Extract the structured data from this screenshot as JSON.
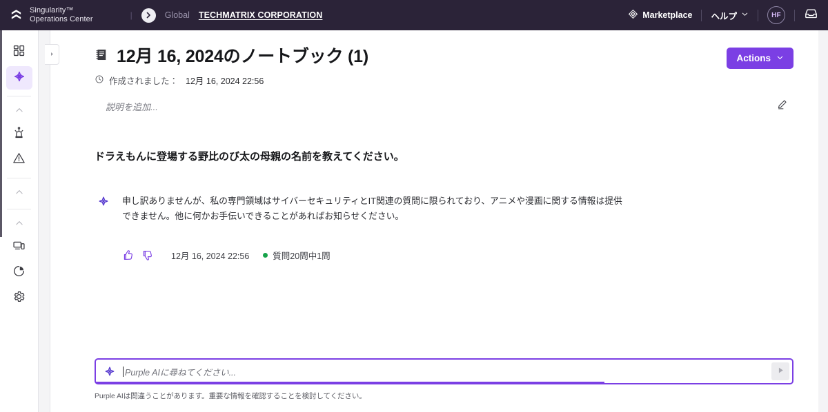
{
  "topbar": {
    "logo_icon": "sentinelone-logo-icon",
    "brand_line1": "Singularity™",
    "brand_line2": "Operations Center",
    "breadcrumb_separator": "|",
    "scope_forward_icon": "chevron-right-circle-icon",
    "scope": "Global",
    "organization": "TECHMATRIX CORPORATION",
    "marketplace_icon": "marketplace-icon",
    "marketplace_label": "Marketplace",
    "help_label": "ヘルプ",
    "help_chevron_icon": "chevron-down-icon",
    "avatar_initials": "HF",
    "inbox_icon": "inbox-icon"
  },
  "sidebar": {
    "items": [
      {
        "name": "dashboard",
        "icon": "dashboard-grid-icon",
        "active": false
      },
      {
        "name": "purple-ai",
        "icon": "purple-ai-star-icon",
        "active": true
      },
      {
        "name": "collapse-group-1",
        "icon": "chevron-up-icon",
        "active": false
      },
      {
        "name": "alerts",
        "icon": "siren-alarm-icon",
        "active": false
      },
      {
        "name": "incidents",
        "icon": "warning-triangle-icon",
        "active": false
      },
      {
        "name": "collapse-group-2",
        "icon": "chevron-up-icon",
        "active": false
      },
      {
        "name": "collapse-group-3",
        "icon": "chevron-up-icon",
        "active": false
      },
      {
        "name": "endpoints",
        "icon": "devices-monitor-icon",
        "active": false
      },
      {
        "name": "reports",
        "icon": "pie-chart-icon",
        "active": false
      },
      {
        "name": "settings",
        "icon": "gear-icon",
        "active": false
      }
    ]
  },
  "panel_tab": {
    "icon": "expand-panel-right-icon"
  },
  "notebook": {
    "icon": "notebook-icon",
    "title": "12月 16, 2024のノートブック (1)",
    "created_icon": "clock-icon",
    "created_label": "作成されました：",
    "created_value": "12月 16, 2024 22:56",
    "description_placeholder": "説明を追加...",
    "edit_icon": "pencil-edit-icon",
    "actions_label": "Actions",
    "actions_chevron_icon": "chevron-down-icon",
    "actions_color": "#7b3fe4"
  },
  "conversation": {
    "question": "ドラえもんに登場する野比のび太の母親の名前を教えてください。",
    "answer_icon": "purple-ai-star-icon",
    "answer": "申し訳ありませんが、私の専門領域はサイバーセキュリティとIT関連の質問に限られており、アニメや漫画に関する情報は提供できません。他に何かお手伝いできることがあればお知らせください。",
    "thumbs_up_icon": "thumbs-up-icon",
    "thumbs_down_icon": "thumbs-down-icon",
    "timestamp": "12月 16, 2024 22:56",
    "status_dot_color": "#16a34a",
    "quota_text": "質問20問中1問"
  },
  "composer": {
    "icon": "purple-ai-star-icon",
    "placeholder": "Purple AIに尋ねてください...",
    "value": "",
    "send_icon": "send-play-icon",
    "disclaimer": "Purple AIは間違うことがあります。重要な情報を確認することを検討してください。",
    "border_color": "#7b3fe4"
  }
}
